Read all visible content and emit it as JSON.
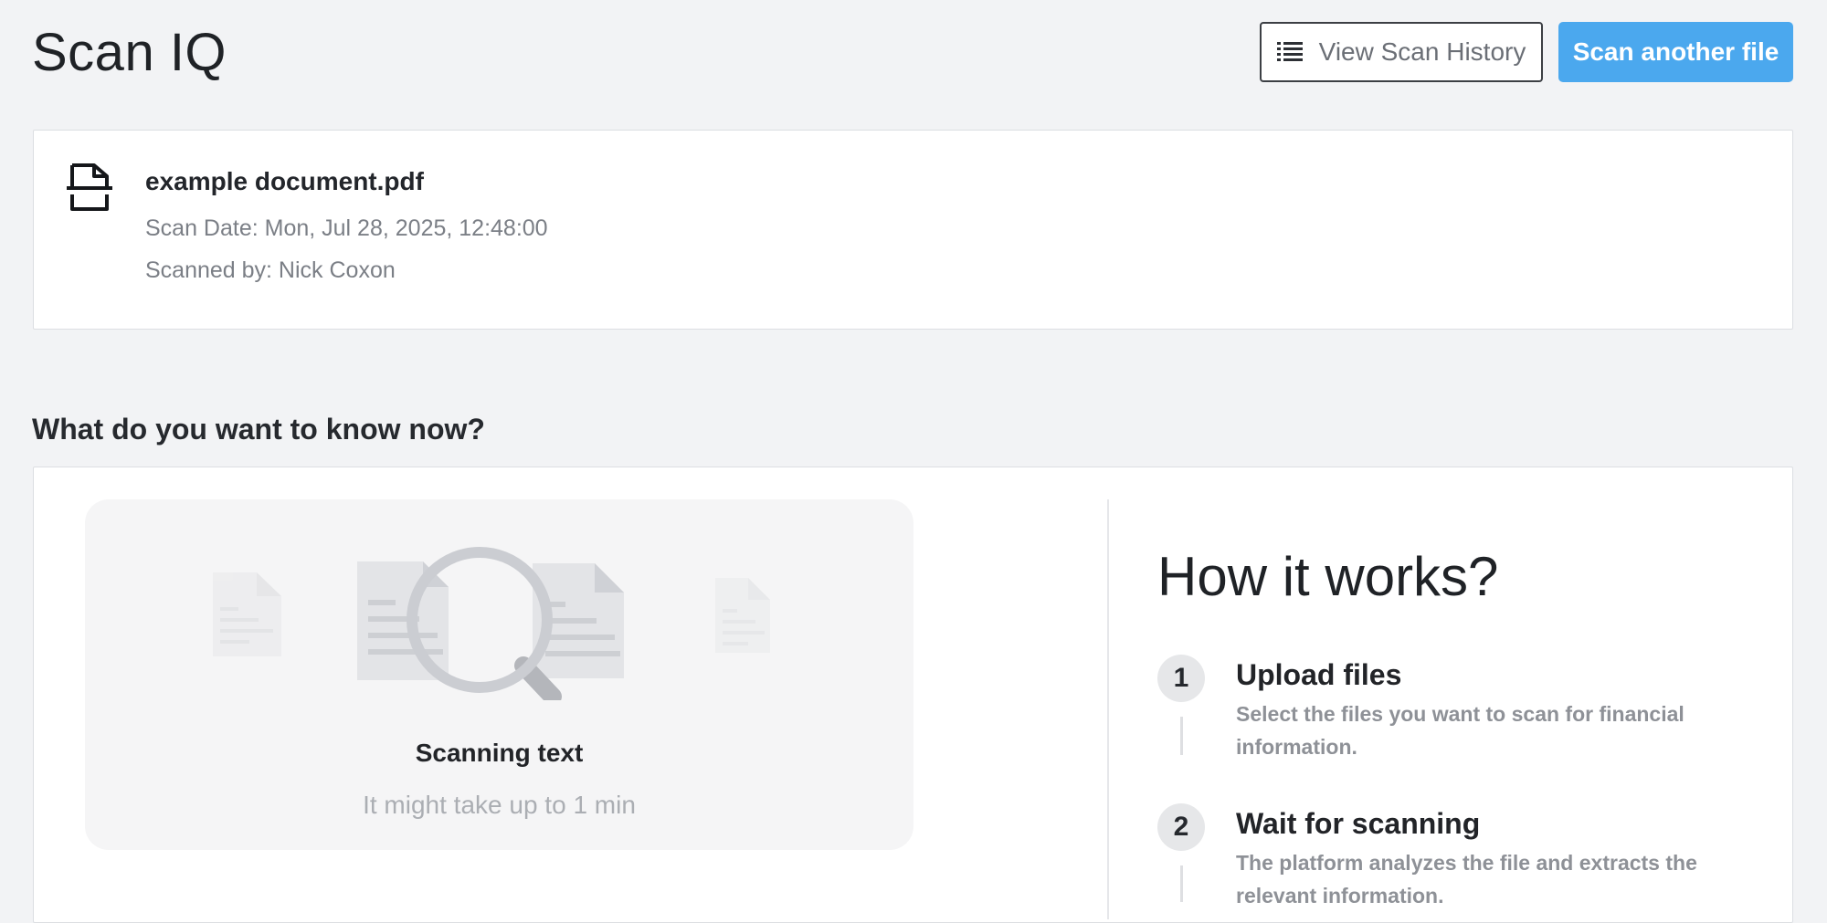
{
  "app": {
    "title": "Scan IQ"
  },
  "header": {
    "history_button_label": "View Scan History",
    "history_icon": "list-icon",
    "primary_button_label": "Scan another file"
  },
  "file": {
    "icon": "document-icon",
    "name": "example document.pdf",
    "scan_date": "Scan Date: Mon, Jul 28, 2025, 12:48:00",
    "scanned_by": "Scanned by: Nick Coxon"
  },
  "section": {
    "title": "What do you want to know now?"
  },
  "scanning": {
    "status": "Scanning text",
    "note": "It might take up to 1 min",
    "illustration": "magnifier-over-documents"
  },
  "how_it_works": {
    "title": "How it works?",
    "steps": [
      {
        "number": "1",
        "title": "Upload files",
        "description": "Select the files you want to scan for financial information."
      },
      {
        "number": "2",
        "title": "Wait for scanning",
        "description": "The platform analyzes the file and extracts the relevant information."
      }
    ]
  },
  "colors": {
    "background": "#f2f3f5",
    "accent": "#4ba8ee",
    "card": "#ffffff",
    "muted_text": "#8e9197"
  }
}
